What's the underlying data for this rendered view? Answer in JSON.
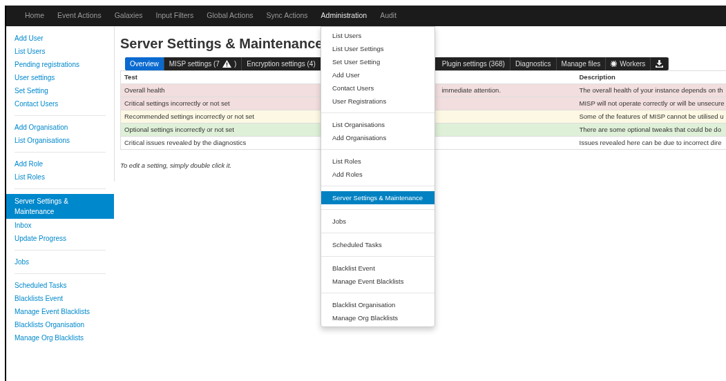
{
  "navbar": {
    "items": [
      {
        "label": "Home",
        "selected": false
      },
      {
        "label": "Event Actions",
        "selected": false
      },
      {
        "label": "Galaxies",
        "selected": false
      },
      {
        "label": "Input Filters",
        "selected": false
      },
      {
        "label": "Global Actions",
        "selected": false
      },
      {
        "label": "Sync Actions",
        "selected": false
      },
      {
        "label": "Administration",
        "selected": true
      },
      {
        "label": "Audit",
        "selected": false
      }
    ]
  },
  "sidebar": {
    "groups": [
      [
        {
          "label": "Add User",
          "selected": false
        },
        {
          "label": "List Users",
          "selected": false
        },
        {
          "label": "Pending registrations",
          "selected": false
        },
        {
          "label": "User settings",
          "selected": false
        },
        {
          "label": "Set Setting",
          "selected": false
        },
        {
          "label": "Contact Users",
          "selected": false
        }
      ],
      [
        {
          "label": "Add Organisation",
          "selected": false
        },
        {
          "label": "List Organisations",
          "selected": false
        }
      ],
      [
        {
          "label": "Add Role",
          "selected": false
        },
        {
          "label": "List Roles",
          "selected": false
        }
      ],
      [
        {
          "label": "Server Settings & Maintenance",
          "selected": true
        },
        {
          "label": "Inbox",
          "selected": false
        },
        {
          "label": "Update Progress",
          "selected": false
        }
      ],
      [
        {
          "label": "Jobs",
          "selected": false
        }
      ],
      [
        {
          "label": "Scheduled Tasks",
          "selected": false
        },
        {
          "label": "Blacklists Event",
          "selected": false
        },
        {
          "label": "Manage Event Blacklists",
          "selected": false
        },
        {
          "label": "Blacklists Organisation",
          "selected": false
        },
        {
          "label": "Manage Org Blacklists",
          "selected": false
        }
      ]
    ]
  },
  "page": {
    "title": "Server Settings & Maintenance",
    "tabs": [
      {
        "kind": "text",
        "label": "Overview",
        "selected": true
      },
      {
        "kind": "warning",
        "label": "MISP settings (7",
        "after": ")",
        "selected": false
      },
      {
        "kind": "text",
        "label": "Encryption settings (4)",
        "selected": false
      },
      {
        "kind": "text",
        "label": "Plugin settings (368)",
        "gap_before": true,
        "selected": false
      },
      {
        "kind": "text",
        "label": "Diagnostics",
        "selected": false
      },
      {
        "kind": "text",
        "label": "Manage files",
        "selected": false
      },
      {
        "kind": "workers",
        "label": "Workers",
        "selected": false
      },
      {
        "kind": "download",
        "selected": false
      }
    ],
    "table": {
      "columns": [
        "Test",
        "Description"
      ],
      "rows": [
        {
          "color": "#f2dede",
          "test": "Overall health",
          "column_2": "immediate attention.",
          "description": "The overall health of your instance depends on th"
        },
        {
          "color": "#f2dede",
          "test": "Critical settings incorrectly or not set",
          "description": "MISP will not operate correctly or will be unsecure"
        },
        {
          "color": "#fcf8e3",
          "test": "Recommended settings incorrectly or not set",
          "description": "Some of the features of MISP cannot be utilised u"
        },
        {
          "color": "#dff0d8",
          "test": "Optional settings incorrectly or not set",
          "description": "There are some optional tweaks that could be do"
        },
        {
          "color": "#ffffff",
          "test": "Critical issues revealed by the diagnostics",
          "description": "Issues revealed here can be due to incorrect dire"
        }
      ]
    },
    "note": "To edit a setting, simply double click it."
  },
  "dropdown": {
    "groups": [
      [
        {
          "label": "List Users",
          "selected": false
        },
        {
          "label": "List User Settings",
          "selected": false
        },
        {
          "label": "Set User Setting",
          "selected": false
        },
        {
          "label": "Add User",
          "selected": false
        },
        {
          "label": "Contact Users",
          "selected": false
        },
        {
          "label": "User Registrations",
          "selected": false
        }
      ],
      [
        {
          "label": "List Organisations",
          "selected": false
        },
        {
          "label": "Add Organisations",
          "selected": false
        }
      ],
      [
        {
          "label": "List Roles",
          "selected": false
        },
        {
          "label": "Add Roles",
          "selected": false
        }
      ],
      [
        {
          "label": "Server Settings & Maintenance",
          "selected": true
        }
      ],
      [
        {
          "label": "Jobs",
          "selected": false
        }
      ],
      [
        {
          "label": "Scheduled Tasks",
          "selected": false
        }
      ],
      [
        {
          "label": "Blacklist Event",
          "selected": false
        },
        {
          "label": "Manage Event Blacklists",
          "selected": false
        }
      ],
      [
        {
          "label": "Blacklist Organisation",
          "selected": false
        },
        {
          "label": "Manage Org Blacklists",
          "selected": false
        }
      ]
    ]
  }
}
